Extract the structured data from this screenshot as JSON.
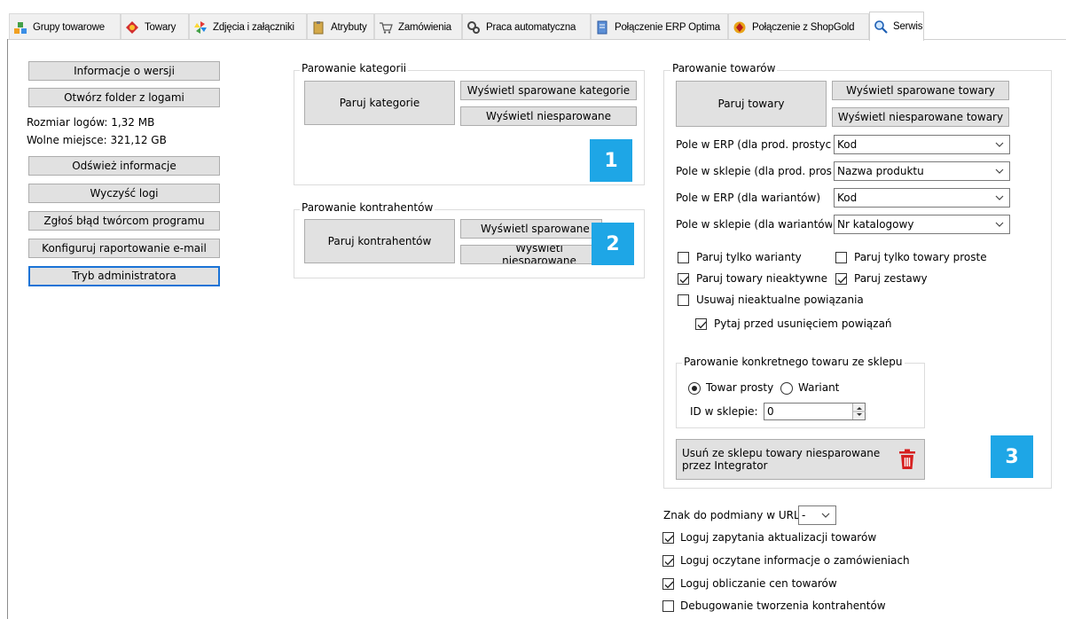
{
  "tabs": [
    {
      "label": "Grupy towarowe",
      "icon": "product-groups-icon"
    },
    {
      "label": "Towary",
      "icon": "products-icon"
    },
    {
      "label": "Zdjęcia i załączniki",
      "icon": "pinwheel-icon"
    },
    {
      "label": "Atrybuty",
      "icon": "clipboard-icon"
    },
    {
      "label": "Zamówienia",
      "icon": "cart-icon"
    },
    {
      "label": "Praca automatyczna",
      "icon": "gears-icon"
    },
    {
      "label": "Połączenie ERP Optima",
      "icon": "server-icon"
    },
    {
      "label": "Połączenie z ShopGold",
      "icon": "shopgold-logo-icon"
    },
    {
      "label": "Serwis",
      "icon": "magnifier-icon"
    }
  ],
  "left": {
    "info_button": "Informacje o wersji",
    "open_logs_button": "Otwórz folder z logami",
    "log_size": "Rozmiar logów: 1,32 MB",
    "free_space": "Wolne miejsce: 321,12 GB",
    "refresh_button": "Odśwież informacje",
    "clear_logs_button": "Wyczyść logi",
    "report_bug_button": "Zgłoś błąd twórcom programu",
    "email_report_button": "Konfiguruj raportowanie e-mail",
    "admin_mode_button": "Tryb administratora"
  },
  "categories": {
    "title": "Parowanie kategorii",
    "pair_button": "Paruj kategorie",
    "show_paired_button": "Wyświetl sparowane kategorie",
    "show_unpaired_button": "Wyświetl niesparowane",
    "badge": "1"
  },
  "contractors": {
    "title": "Parowanie kontrahentów",
    "pair_button": "Paruj kontrahentów",
    "show_paired_button": "Wyświetl sparowane",
    "show_unpaired_button": "Wyświetl niesparowane",
    "badge": "2"
  },
  "products": {
    "title": "Parowanie towarów",
    "pair_button": "Paruj towary",
    "show_paired_button": "Wyświetl sparowane towary",
    "show_unpaired_button": "Wyświetl niesparowane towary",
    "fields": [
      {
        "label": "Pole w ERP (dla prod. prostych)",
        "value": "Kod"
      },
      {
        "label": "Pole w sklepie (dla prod. prostych)",
        "value": "Nazwa produktu"
      },
      {
        "label": "Pole w ERP (dla wariantów)",
        "value": "Kod"
      },
      {
        "label": "Pole w sklepie (dla wariantów)",
        "value": "Nr katalogowy"
      }
    ],
    "checkboxes": [
      {
        "label": "Paruj tylko warianty",
        "checked": false
      },
      {
        "label": "Paruj tylko towary proste",
        "checked": false
      },
      {
        "label": "Paruj towary nieaktywne",
        "checked": true
      },
      {
        "label": "Paruj zestawy",
        "checked": true
      },
      {
        "label": "Usuwaj nieaktualne powiązania",
        "checked": false
      },
      {
        "label": "Pytaj przed usunięciem powiązań",
        "checked": true
      }
    ],
    "specific": {
      "title": "Parowanie konkretnego towaru ze sklepu",
      "radio_simple": "Towar prosty",
      "radio_variant": "Wariant",
      "selected": "Towar prosty",
      "id_label": "ID w sklepie:",
      "id_value": "0"
    },
    "delete_button": "Usuń ze sklepu towary niesparowane przez Integrator",
    "badge": "3"
  },
  "bottom": {
    "url_char_label": "Znak do podmiany w URL",
    "url_char_value": "-",
    "checkboxes": [
      {
        "label": "Loguj zapytania aktualizacji towarów",
        "checked": true
      },
      {
        "label": "Loguj oczytane informacje o zamówieniach",
        "checked": true
      },
      {
        "label": "Loguj obliczanie cen towarów",
        "checked": true
      },
      {
        "label": "Debugowanie tworzenia kontrahentów",
        "checked": false
      }
    ]
  },
  "colors": {
    "badge": "#1ea6e6",
    "button_face": "#e1e1e1",
    "focus_border": "#1a73d6",
    "trash": "#d62020"
  }
}
